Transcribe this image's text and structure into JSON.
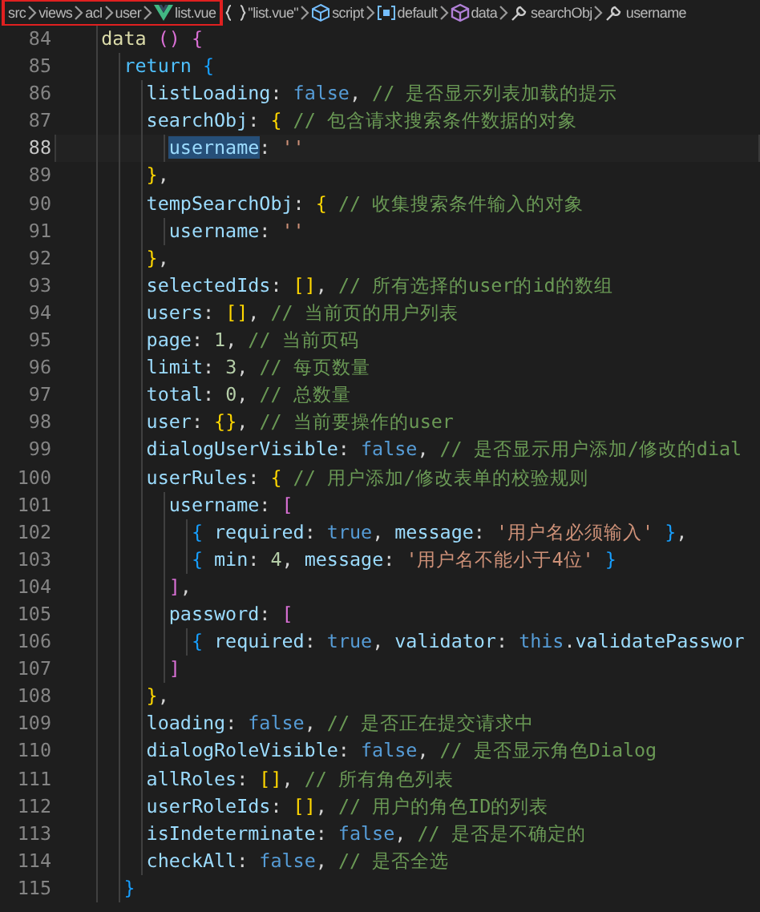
{
  "breadcrumb": {
    "outlined": [
      {
        "kind": "folder",
        "label": "src"
      },
      {
        "kind": "folder",
        "label": "views"
      },
      {
        "kind": "folder",
        "label": "acl"
      },
      {
        "kind": "folder",
        "label": "user"
      },
      {
        "kind": "vue",
        "label": "list.vue"
      }
    ],
    "rest": [
      {
        "kind": "module",
        "label": "\"list.vue\""
      },
      {
        "kind": "script",
        "label": "script"
      },
      {
        "kind": "variable",
        "label": "default"
      },
      {
        "kind": "method",
        "label": "data"
      },
      {
        "kind": "property",
        "label": "searchObj"
      },
      {
        "kind": "property",
        "label": "username"
      }
    ]
  },
  "lines": [
    {
      "number": "84",
      "selected": false,
      "tokens": [
        {
          "kind": "fn",
          "text": "    data"
        },
        {
          "kind": "b2",
          "text": " ()"
        },
        {
          "kind": "b2",
          "text": " {"
        }
      ]
    },
    {
      "number": "85",
      "selected": false,
      "tokens": [
        {
          "kind": "kw",
          "text": "      return"
        },
        {
          "kind": "b3",
          "text": " {"
        }
      ]
    },
    {
      "number": "86",
      "selected": false,
      "tokens": [
        {
          "kind": "key",
          "text": "        listLoading"
        },
        {
          "kind": "p",
          "text": ": "
        },
        {
          "kind": "const",
          "text": "false"
        },
        {
          "kind": "p",
          "text": ", "
        },
        {
          "kind": "comment",
          "text": "// 是否显示列表加载的提示"
        }
      ]
    },
    {
      "number": "87",
      "selected": false,
      "tokens": [
        {
          "kind": "key",
          "text": "        searchObj"
        },
        {
          "kind": "p",
          "text": ": "
        },
        {
          "kind": "b1",
          "text": "{"
        },
        {
          "kind": "comment",
          "text": " // 包含请求搜索条件数据的对象"
        }
      ]
    },
    {
      "number": "88",
      "selected": true,
      "tokens": [
        {
          "kind": "key",
          "text": "          username"
        },
        {
          "kind": "p",
          "text": ": "
        },
        {
          "kind": "str",
          "text": "''"
        }
      ]
    },
    {
      "number": "89",
      "selected": false,
      "tokens": [
        {
          "kind": "b1",
          "text": "        }"
        },
        {
          "kind": "p",
          "text": ","
        }
      ]
    },
    {
      "number": "90",
      "selected": false,
      "tokens": [
        {
          "kind": "key",
          "text": "        tempSearchObj"
        },
        {
          "kind": "p",
          "text": ": "
        },
        {
          "kind": "b1",
          "text": "{"
        },
        {
          "kind": "comment",
          "text": " // 收集搜索条件输入的对象"
        }
      ]
    },
    {
      "number": "91",
      "selected": false,
      "tokens": [
        {
          "kind": "key",
          "text": "          username"
        },
        {
          "kind": "p",
          "text": ": "
        },
        {
          "kind": "str",
          "text": "''"
        }
      ]
    },
    {
      "number": "92",
      "selected": false,
      "tokens": [
        {
          "kind": "b1",
          "text": "        }"
        },
        {
          "kind": "p",
          "text": ","
        }
      ]
    },
    {
      "number": "93",
      "selected": false,
      "tokens": [
        {
          "kind": "key",
          "text": "        selectedIds"
        },
        {
          "kind": "p",
          "text": ": "
        },
        {
          "kind": "b1",
          "text": "[]"
        },
        {
          "kind": "p",
          "text": ", "
        },
        {
          "kind": "comment",
          "text": "// 所有选择的user的id的数组"
        }
      ]
    },
    {
      "number": "94",
      "selected": false,
      "tokens": [
        {
          "kind": "key",
          "text": "        users"
        },
        {
          "kind": "p",
          "text": ": "
        },
        {
          "kind": "b1",
          "text": "[]"
        },
        {
          "kind": "p",
          "text": ", "
        },
        {
          "kind": "comment",
          "text": "// 当前页的用户列表"
        }
      ]
    },
    {
      "number": "95",
      "selected": false,
      "tokens": [
        {
          "kind": "key",
          "text": "        page"
        },
        {
          "kind": "p",
          "text": ": "
        },
        {
          "kind": "num",
          "text": "1"
        },
        {
          "kind": "p",
          "text": ", "
        },
        {
          "kind": "comment",
          "text": "// 当前页码"
        }
      ]
    },
    {
      "number": "96",
      "selected": false,
      "tokens": [
        {
          "kind": "key",
          "text": "        limit"
        },
        {
          "kind": "p",
          "text": ": "
        },
        {
          "kind": "num",
          "text": "3"
        },
        {
          "kind": "p",
          "text": ", "
        },
        {
          "kind": "comment",
          "text": "// 每页数量"
        }
      ]
    },
    {
      "number": "97",
      "selected": false,
      "tokens": [
        {
          "kind": "key",
          "text": "        total"
        },
        {
          "kind": "p",
          "text": ": "
        },
        {
          "kind": "num",
          "text": "0"
        },
        {
          "kind": "p",
          "text": ", "
        },
        {
          "kind": "comment",
          "text": "// 总数量"
        }
      ]
    },
    {
      "number": "98",
      "selected": false,
      "tokens": [
        {
          "kind": "key",
          "text": "        user"
        },
        {
          "kind": "p",
          "text": ": "
        },
        {
          "kind": "b1",
          "text": "{}"
        },
        {
          "kind": "p",
          "text": ", "
        },
        {
          "kind": "comment",
          "text": "// 当前要操作的user"
        }
      ]
    },
    {
      "number": "99",
      "selected": false,
      "tokens": [
        {
          "kind": "key",
          "text": "        dialogUserVisible"
        },
        {
          "kind": "p",
          "text": ": "
        },
        {
          "kind": "const",
          "text": "false"
        },
        {
          "kind": "p",
          "text": ", "
        },
        {
          "kind": "comment",
          "text": "// 是否显示用户添加/修改的dial"
        }
      ]
    },
    {
      "number": "100",
      "selected": false,
      "tokens": [
        {
          "kind": "key",
          "text": "        userRules"
        },
        {
          "kind": "p",
          "text": ": "
        },
        {
          "kind": "b1",
          "text": "{"
        },
        {
          "kind": "comment",
          "text": " // 用户添加/修改表单的校验规则"
        }
      ]
    },
    {
      "number": "101",
      "selected": false,
      "tokens": [
        {
          "kind": "key",
          "text": "          username"
        },
        {
          "kind": "p",
          "text": ": "
        },
        {
          "kind": "b2",
          "text": "["
        }
      ]
    },
    {
      "number": "102",
      "selected": false,
      "tokens": [
        {
          "kind": "b3",
          "text": "            {"
        },
        {
          "kind": "key",
          "text": " required"
        },
        {
          "kind": "p",
          "text": ": "
        },
        {
          "kind": "const",
          "text": "true"
        },
        {
          "kind": "p",
          "text": ", "
        },
        {
          "kind": "key",
          "text": "message"
        },
        {
          "kind": "p",
          "text": ": "
        },
        {
          "kind": "str",
          "text": "'用户名必须输入'"
        },
        {
          "kind": "b3",
          "text": " }"
        },
        {
          "kind": "p",
          "text": ","
        }
      ]
    },
    {
      "number": "103",
      "selected": false,
      "tokens": [
        {
          "kind": "b3",
          "text": "            {"
        },
        {
          "kind": "key",
          "text": " min"
        },
        {
          "kind": "p",
          "text": ": "
        },
        {
          "kind": "num",
          "text": "4"
        },
        {
          "kind": "p",
          "text": ", "
        },
        {
          "kind": "key",
          "text": "message"
        },
        {
          "kind": "p",
          "text": ": "
        },
        {
          "kind": "str",
          "text": "'用户名不能小于4位'"
        },
        {
          "kind": "b3",
          "text": " }"
        }
      ]
    },
    {
      "number": "104",
      "selected": false,
      "tokens": [
        {
          "kind": "b2",
          "text": "          ]"
        },
        {
          "kind": "p",
          "text": ","
        }
      ]
    },
    {
      "number": "105",
      "selected": false,
      "tokens": [
        {
          "kind": "key",
          "text": "          password"
        },
        {
          "kind": "p",
          "text": ": "
        },
        {
          "kind": "b2",
          "text": "["
        }
      ]
    },
    {
      "number": "106",
      "selected": false,
      "tokens": [
        {
          "kind": "b3",
          "text": "            {"
        },
        {
          "kind": "key",
          "text": " required"
        },
        {
          "kind": "p",
          "text": ": "
        },
        {
          "kind": "const",
          "text": "true"
        },
        {
          "kind": "p",
          "text": ", "
        },
        {
          "kind": "key",
          "text": "validator"
        },
        {
          "kind": "p",
          "text": ": "
        },
        {
          "kind": "const",
          "text": "this"
        },
        {
          "kind": "p",
          "text": "."
        },
        {
          "kind": "key",
          "text": "validatePasswor"
        }
      ]
    },
    {
      "number": "107",
      "selected": false,
      "tokens": [
        {
          "kind": "b2",
          "text": "          ]"
        }
      ]
    },
    {
      "number": "108",
      "selected": false,
      "tokens": [
        {
          "kind": "b1",
          "text": "        }"
        },
        {
          "kind": "p",
          "text": ","
        }
      ]
    },
    {
      "number": "109",
      "selected": false,
      "tokens": [
        {
          "kind": "key",
          "text": "        loading"
        },
        {
          "kind": "p",
          "text": ": "
        },
        {
          "kind": "const",
          "text": "false"
        },
        {
          "kind": "p",
          "text": ", "
        },
        {
          "kind": "comment",
          "text": "// 是否正在提交请求中"
        }
      ]
    },
    {
      "number": "110",
      "selected": false,
      "tokens": [
        {
          "kind": "key",
          "text": "        dialogRoleVisible"
        },
        {
          "kind": "p",
          "text": ": "
        },
        {
          "kind": "const",
          "text": "false"
        },
        {
          "kind": "p",
          "text": ", "
        },
        {
          "kind": "comment",
          "text": "// 是否显示角色Dialog"
        }
      ]
    },
    {
      "number": "111",
      "selected": false,
      "tokens": [
        {
          "kind": "key",
          "text": "        allRoles"
        },
        {
          "kind": "p",
          "text": ": "
        },
        {
          "kind": "b1",
          "text": "[]"
        },
        {
          "kind": "p",
          "text": ", "
        },
        {
          "kind": "comment",
          "text": "// 所有角色列表"
        }
      ]
    },
    {
      "number": "112",
      "selected": false,
      "tokens": [
        {
          "kind": "key",
          "text": "        userRoleIds"
        },
        {
          "kind": "p",
          "text": ": "
        },
        {
          "kind": "b1",
          "text": "[]"
        },
        {
          "kind": "p",
          "text": ", "
        },
        {
          "kind": "comment",
          "text": "// 用户的角色ID的列表"
        }
      ]
    },
    {
      "number": "113",
      "selected": false,
      "tokens": [
        {
          "kind": "key",
          "text": "        isIndeterminate"
        },
        {
          "kind": "p",
          "text": ": "
        },
        {
          "kind": "const",
          "text": "false"
        },
        {
          "kind": "p",
          "text": ", "
        },
        {
          "kind": "comment",
          "text": "// 是否是不确定的"
        }
      ]
    },
    {
      "number": "114",
      "selected": false,
      "tokens": [
        {
          "kind": "key",
          "text": "        checkAll"
        },
        {
          "kind": "p",
          "text": ": "
        },
        {
          "kind": "const",
          "text": "false"
        },
        {
          "kind": "p",
          "text": ", "
        },
        {
          "kind": "comment",
          "text": "// 是否全选"
        }
      ]
    },
    {
      "number": "115",
      "selected": false,
      "tokens": [
        {
          "kind": "b3",
          "text": "      }"
        }
      ]
    }
  ]
}
